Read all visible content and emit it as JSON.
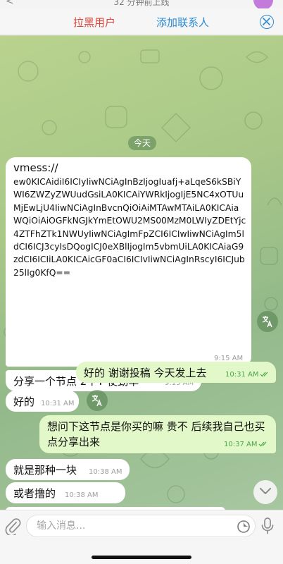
{
  "top_bar": {
    "status_text": "32 分钟前上线",
    "back_label": "<"
  },
  "action_bar": {
    "block_label": "拉黑用户",
    "add_contact_label": "添加联系人",
    "close_icon": "close-circle-icon"
  },
  "chat": {
    "date_chip": "今天",
    "messages": [
      {
        "direction": "in",
        "head": "vmess://",
        "text": "ew0KICAidiI6ICIyIiwNCiAgInBzIjogIuafj+aLqeS6kSBiYWI6ZWZyZWUudGsiLA0KICAiYWRkIjogIjE5NC4xOTUuMjEwLjU4IiwNCiAgInBvcnQiOiAiMTAwMTAiLA0KICAiaWQiOiAiOGFkNGJkYmEtOWU2MS00MzM0LWIyZDEtYjc4ZTFhZTk1NWUyIiwNCiAgImFpZCI6ICIwIiwNCiAgIm5ldCI6ICJ3cyIsDQogICJ0eXBlIjogIm5vbmUiLA0KICAiaG9zdCI6ICIiLA0KICAicGF0aCI6ICIvIiwNCiAgInRscyI6ICJub25lIg0KfQ==",
        "time": "9:15 AM"
      },
      {
        "direction": "in",
        "text": "分享一个节点  2个T  使劲草",
        "time": "9:15 AM"
      },
      {
        "direction": "out",
        "text": "好的  谢谢投稿  今天发上去",
        "time": "10:31 AM"
      },
      {
        "direction": "in",
        "text": "好的",
        "time": "10:31 AM"
      },
      {
        "direction": "out",
        "text": "想问下这节点是你买的嘛 贵不 后续我自己也买点分享出来",
        "time": "10:37 AM"
      },
      {
        "direction": "in",
        "text": "就是那种一块",
        "time": "10:38 AM"
      },
      {
        "direction": "in",
        "text": "或者撸的",
        "time": "10:38 AM"
      }
    ]
  },
  "input_bar": {
    "placeholder": "输入消息..."
  },
  "colors": {
    "block_red": "#e0453a",
    "accent_blue": "#2b8ad3",
    "outgoing_bubble": "#e3f8c8",
    "read_ticks_green": "#4aa64a"
  }
}
